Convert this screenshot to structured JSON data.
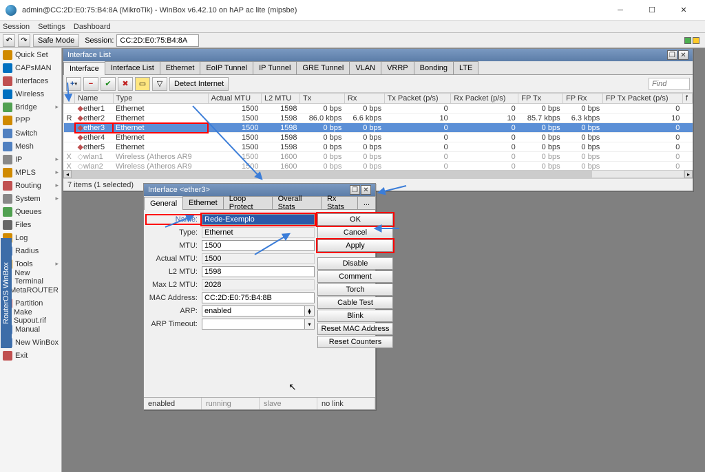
{
  "title": "admin@CC:2D:E0:75:B4:8A (MikroTik) - WinBox v6.42.10 on hAP ac lite (mipsbe)",
  "menu": [
    "Session",
    "Settings",
    "Dashboard"
  ],
  "session_box_label": "Session:",
  "session_id": "CC:2D:E0:75:B4:8A",
  "safe_mode": "Safe Mode",
  "sidebar": {
    "items": [
      {
        "l": "Quick Set",
        "c": "#d08a00"
      },
      {
        "l": "CAPsMAN",
        "c": "#0070c0"
      },
      {
        "l": "Interfaces",
        "c": "#c05050"
      },
      {
        "l": "Wireless",
        "c": "#0070c0"
      },
      {
        "l": "Bridge",
        "c": "#50a050",
        "caret": true
      },
      {
        "l": "PPP",
        "c": "#d08a00"
      },
      {
        "l": "Switch",
        "c": "#5080c0"
      },
      {
        "l": "Mesh",
        "c": "#5080c0"
      },
      {
        "l": "IP",
        "c": "#888",
        "caret": true
      },
      {
        "l": "MPLS",
        "c": "#d08a00",
        "caret": true
      },
      {
        "l": "Routing",
        "c": "#c05050",
        "caret": true
      },
      {
        "l": "System",
        "c": "#888",
        "caret": true
      },
      {
        "l": "Queues",
        "c": "#50a050"
      },
      {
        "l": "Files",
        "c": "#666"
      },
      {
        "l": "Log",
        "c": "#d08a00"
      },
      {
        "l": "Radius",
        "c": "#5080c0"
      },
      {
        "l": "Tools",
        "c": "#d08a00",
        "caret": true
      },
      {
        "l": "New Terminal",
        "c": "#333"
      },
      {
        "l": "MetaROUTER",
        "c": "#5080c0"
      },
      {
        "l": "Partition",
        "c": "#c05050"
      },
      {
        "l": "Make Supout.rif",
        "c": "#d08a00"
      },
      {
        "l": "Manual",
        "c": "#5080c0"
      },
      {
        "l": "New WinBox",
        "c": "#5080c0"
      },
      {
        "l": "Exit",
        "c": "#c05050"
      }
    ]
  },
  "list_window": {
    "title": "Interface List",
    "tabs": [
      "Interface",
      "Interface List",
      "Ethernet",
      "EoIP Tunnel",
      "IP Tunnel",
      "GRE Tunnel",
      "VLAN",
      "VRRP",
      "Bonding",
      "LTE"
    ],
    "detect_btn": "Detect Internet",
    "find": "Find",
    "cols": [
      "",
      "Name",
      "Type",
      "Actual MTU",
      "L2 MTU",
      "Tx",
      "Rx",
      "Tx Packet (p/s)",
      "Rx Packet (p/s)",
      "FP Tx",
      "FP Rx",
      "FP Tx Packet (p/s)",
      "f"
    ],
    "rows": [
      {
        "flag": "",
        "name": "ether1",
        "type": "Ethernet",
        "amtu": "1500",
        "l2": "1598",
        "tx": "0 bps",
        "rx": "0 bps",
        "txp": "0",
        "rxp": "0",
        "fptx": "0 bps",
        "fprx": "0 bps",
        "fptxp": "0"
      },
      {
        "flag": "R",
        "name": "ether2",
        "type": "Ethernet",
        "amtu": "1500",
        "l2": "1598",
        "tx": "86.0 kbps",
        "rx": "6.6 kbps",
        "txp": "10",
        "rxp": "10",
        "fptx": "85.7 kbps",
        "fprx": "6.3 kbps",
        "fptxp": "10"
      },
      {
        "flag": "",
        "name": "ether3",
        "type": "Ethernet",
        "amtu": "1500",
        "l2": "1598",
        "tx": "0 bps",
        "rx": "0 bps",
        "txp": "0",
        "rxp": "0",
        "fptx": "0 bps",
        "fprx": "0 bps",
        "fptxp": "0",
        "sel": true
      },
      {
        "flag": "",
        "name": "ether4",
        "type": "Ethernet",
        "amtu": "1500",
        "l2": "1598",
        "tx": "0 bps",
        "rx": "0 bps",
        "txp": "0",
        "rxp": "0",
        "fptx": "0 bps",
        "fprx": "0 bps",
        "fptxp": "0"
      },
      {
        "flag": "",
        "name": "ether5",
        "type": "Ethernet",
        "amtu": "1500",
        "l2": "1598",
        "tx": "0 bps",
        "rx": "0 bps",
        "txp": "0",
        "rxp": "0",
        "fptx": "0 bps",
        "fprx": "0 bps",
        "fptxp": "0"
      },
      {
        "flag": "X",
        "name": "wlan1",
        "type": "Wireless (Atheros AR9",
        "amtu": "1500",
        "l2": "1600",
        "tx": "0 bps",
        "rx": "0 bps",
        "txp": "0",
        "rxp": "0",
        "fptx": "0 bps",
        "fprx": "0 bps",
        "fptxp": "0",
        "dis": true
      },
      {
        "flag": "X",
        "name": "wlan2",
        "type": "Wireless (Atheros AR9",
        "amtu": "1500",
        "l2": "1600",
        "tx": "0 bps",
        "rx": "0 bps",
        "txp": "0",
        "rxp": "0",
        "fptx": "0 bps",
        "fprx": "0 bps",
        "fptxp": "0",
        "dis": true
      }
    ],
    "footer": "7 items (1 selected)"
  },
  "detail_window": {
    "title": "Interface <ether3>",
    "tabs": [
      "General",
      "Ethernet",
      "Loop Protect",
      "Overall Stats",
      "Rx Stats",
      "..."
    ],
    "fields": {
      "Name": "Rede-Exemplo",
      "Type": "Ethernet",
      "MTU": "1500",
      "Actual MTU": "1500",
      "L2 MTU": "1598",
      "Max L2 MTU": "2028",
      "MAC Address": "CC:2D:E0:75:B4:8B",
      "ARP": "enabled",
      "ARP Timeout": ""
    },
    "buttons": [
      "OK",
      "Cancel",
      "Apply",
      "Disable",
      "Comment",
      "Torch",
      "Cable Test",
      "Blink",
      "Reset MAC Address",
      "Reset Counters"
    ],
    "status": {
      "a": "enabled",
      "b": "running",
      "c": "slave",
      "d": "no link"
    }
  },
  "vtext": "RouterOS WinBox"
}
